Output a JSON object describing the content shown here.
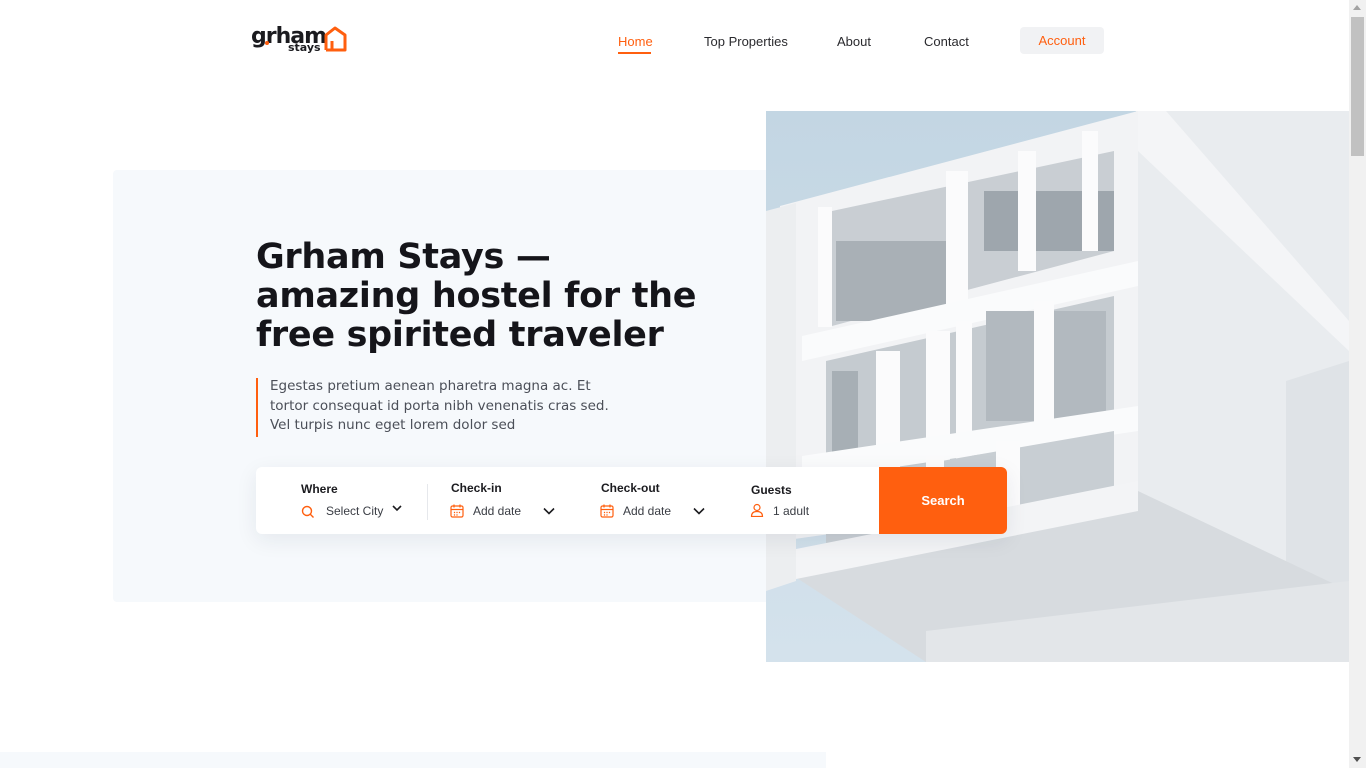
{
  "brand": {
    "logo_word": "grham",
    "logo_sub": "stays",
    "accent": "#ff5f0f"
  },
  "nav": {
    "items": [
      {
        "label": "Home",
        "active": true
      },
      {
        "label": "Top Properties",
        "active": false
      },
      {
        "label": "About",
        "active": false
      },
      {
        "label": "Contact",
        "active": false
      }
    ],
    "account_label": "Account"
  },
  "hero": {
    "title_lines": [
      "Grham Stays —",
      "amazing hostel for the",
      "free spirited traveler"
    ],
    "description": "Egestas pretium aenean pharetra magna ac. Et tortor consequat id porta nibh venenatis cras sed. Vel turpis nunc eget lorem dolor sed",
    "image_icon": "building-photo"
  },
  "search": {
    "where": {
      "label": "Where",
      "value": "Select City",
      "icon": "search-icon"
    },
    "checkin": {
      "label": "Check-in",
      "value": "Add date",
      "icon": "calendar-icon"
    },
    "checkout": {
      "label": "Check-out",
      "value": "Add date",
      "icon": "calendar-icon"
    },
    "guests": {
      "label": "Guests",
      "value": "1 adult",
      "icon": "user-icon"
    },
    "button_label": "Search"
  }
}
